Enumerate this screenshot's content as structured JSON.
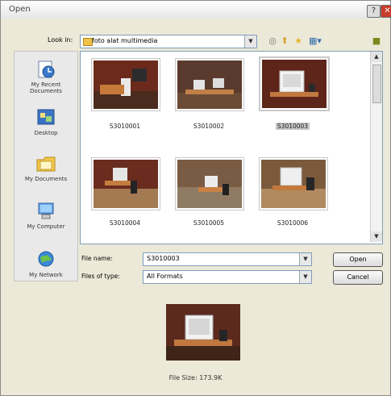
{
  "window": {
    "title": "Open"
  },
  "lookin": {
    "label": "Look in:",
    "value": "foto alat multimedia"
  },
  "places": [
    {
      "line1": "My Recent",
      "line2": "Documents"
    },
    {
      "line1": "Desktop",
      "line2": ""
    },
    {
      "line1": "My Documents",
      "line2": ""
    },
    {
      "line1": "My Computer",
      "line2": ""
    },
    {
      "line1": "My Network",
      "line2": ""
    }
  ],
  "files": [
    {
      "name": "S3010001"
    },
    {
      "name": "S3010002"
    },
    {
      "name": "S3010003"
    },
    {
      "name": "S3010004"
    },
    {
      "name": "S3010005"
    },
    {
      "name": "S3010006"
    }
  ],
  "filename": {
    "label": "File name:",
    "value": "S3010003"
  },
  "filetype": {
    "label": "Files of type:",
    "value": "All Formats"
  },
  "buttons": {
    "open": "Open",
    "cancel": "Cancel"
  },
  "preview": {
    "size_text": "File Size: 173.9K"
  },
  "colors": {
    "accent": "#7f9db9",
    "close": "#c93d2a"
  }
}
